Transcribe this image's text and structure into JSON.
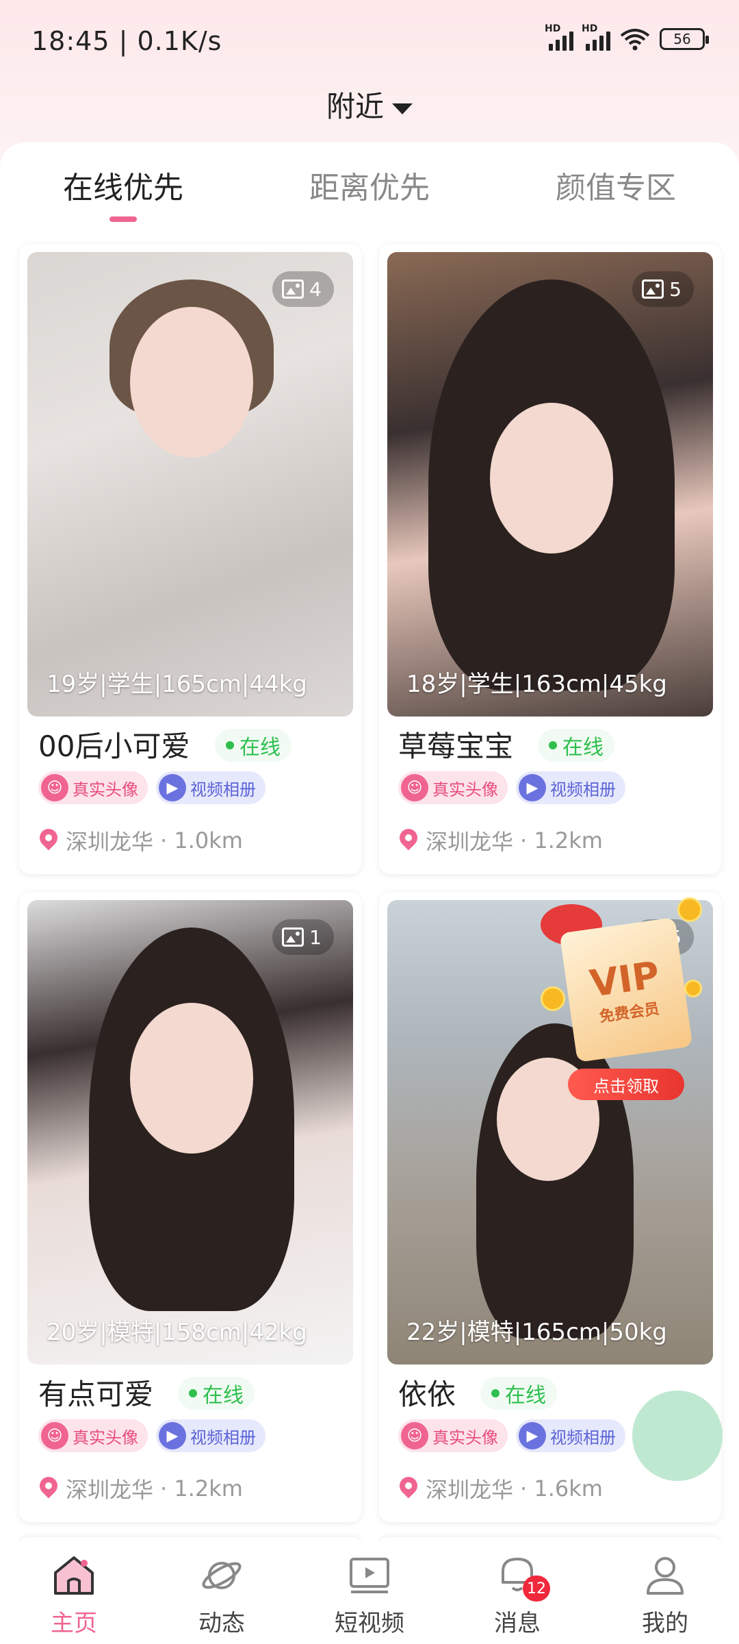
{
  "status_bar": {
    "time": "18:45 | 0.1K/s",
    "signal1": "HD",
    "signal2": "HD",
    "battery": "56"
  },
  "header": {
    "title": "附近"
  },
  "tabs": [
    {
      "label": "在线优先",
      "active": true
    },
    {
      "label": "距离优先",
      "active": false
    },
    {
      "label": "颜值专区",
      "active": false
    }
  ],
  "cards": [
    {
      "name": "00后小可爱",
      "status": "在线",
      "stats": "19岁|学生|165cm|44kg",
      "photo_count": "4",
      "tag_real": "真实头像",
      "tag_video": "视频相册",
      "location": "深圳龙华",
      "distance": "· 1.0km"
    },
    {
      "name": "草莓宝宝",
      "status": "在线",
      "stats": "18岁|学生|163cm|45kg",
      "photo_count": "5",
      "tag_real": "真实头像",
      "tag_video": "视频相册",
      "location": "深圳龙华",
      "distance": "· 1.2km"
    },
    {
      "name": "有点可爱",
      "status": "在线",
      "stats": "20岁|模特|158cm|42kg",
      "photo_count": "1",
      "tag_real": "真实头像",
      "tag_video": "视频相册",
      "location": "深圳龙华",
      "distance": "· 1.2km"
    },
    {
      "name": "依依",
      "status": "在线",
      "stats": "22岁|模特|165cm|50kg",
      "photo_count": "5",
      "tag_real": "真实头像",
      "tag_video": "视频相册",
      "location": "深圳龙华",
      "distance": "· 1.6km"
    }
  ],
  "vip_popup": {
    "main": "VIP",
    "sub": "免费会员",
    "button": "点击领取"
  },
  "bottom_nav": [
    {
      "label": "主页",
      "icon": "home-icon",
      "active": true
    },
    {
      "label": "动态",
      "icon": "planet-icon",
      "active": false
    },
    {
      "label": "短视频",
      "icon": "video-icon",
      "active": false
    },
    {
      "label": "消息",
      "icon": "message-icon",
      "active": false,
      "badge": "12"
    },
    {
      "label": "我的",
      "icon": "profile-icon",
      "active": false
    }
  ],
  "colors": {
    "accent": "#f06590",
    "online": "#2fbf4f",
    "video_tag": "#5b63d6",
    "badge": "#f0283c"
  }
}
